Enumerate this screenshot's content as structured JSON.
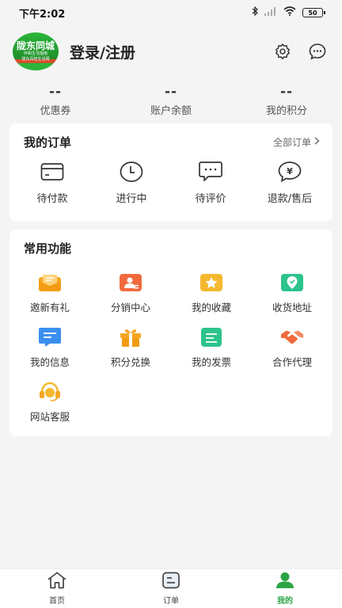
{
  "status_bar": {
    "time": "下午2:02",
    "battery": "50"
  },
  "profile": {
    "avatar_line1": "陇东同城",
    "avatar_line2": "伴和生活指南",
    "avatar_line3": "陇东百姓生活网",
    "login_label": "登录/注册",
    "settings_icon": "gear-icon",
    "message_icon": "chat-icon"
  },
  "stats": [
    {
      "value": "--",
      "label": "优惠券"
    },
    {
      "value": "--",
      "label": "账户余额"
    },
    {
      "value": "--",
      "label": "我的积分"
    }
  ],
  "orders": {
    "title": "我的订单",
    "all_label": "全部订单",
    "items": [
      {
        "label": "待付款",
        "icon": "card-icon"
      },
      {
        "label": "进行中",
        "icon": "clock-icon"
      },
      {
        "label": "待评价",
        "icon": "comment-icon"
      },
      {
        "label": "退款/售后",
        "icon": "refund-icon"
      }
    ]
  },
  "functions": {
    "title": "常用功能",
    "items": [
      {
        "label": "邀新有礼",
        "icon": "invite-icon",
        "color": "#f5a623"
      },
      {
        "label": "分销中心",
        "icon": "distribution-icon",
        "color": "#f06a3e"
      },
      {
        "label": "我的收藏",
        "icon": "star-icon",
        "color": "#f5b82e"
      },
      {
        "label": "收货地址",
        "icon": "location-icon",
        "color": "#2cc38c"
      },
      {
        "label": "我的信息",
        "icon": "message-icon",
        "color": "#3b8ff0"
      },
      {
        "label": "积分兑换",
        "icon": "gift-icon",
        "color": "#f5a623"
      },
      {
        "label": "我的发票",
        "icon": "invoice-icon",
        "color": "#2cc38c"
      },
      {
        "label": "合作代理",
        "icon": "handshake-icon",
        "color": "#f06a3e"
      },
      {
        "label": "网站客服",
        "icon": "headset-icon",
        "color": "#f5b82e"
      }
    ]
  },
  "tabbar": {
    "items": [
      {
        "label": "首页",
        "icon": "home-icon"
      },
      {
        "label": "订单",
        "icon": "order-icon"
      },
      {
        "label": "我的",
        "icon": "user-icon"
      }
    ],
    "active_color": "#2aa545"
  }
}
